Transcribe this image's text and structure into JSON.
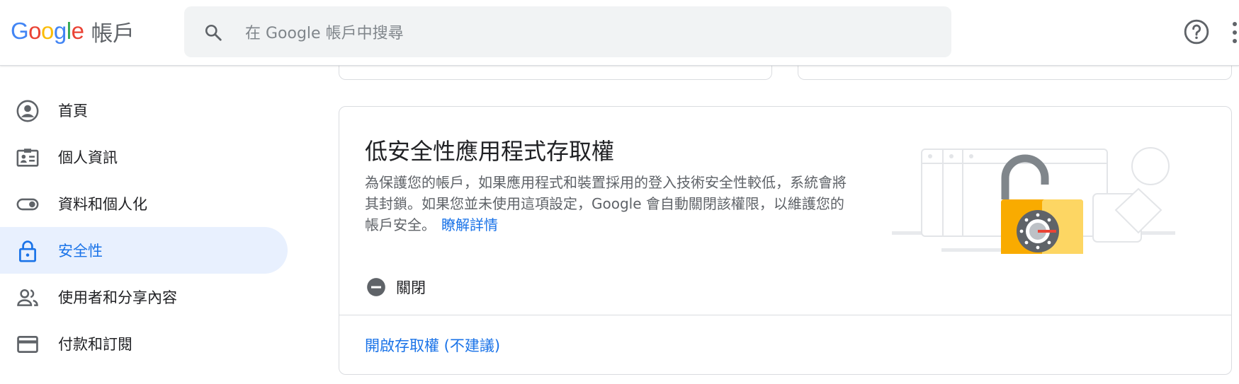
{
  "header": {
    "logo_letters": [
      "G",
      "o",
      "o",
      "g",
      "l",
      "e"
    ],
    "product_name": "帳戶",
    "search_placeholder": "在 Google 帳戶中搜尋"
  },
  "sidebar": {
    "items": [
      {
        "label": "首頁",
        "icon": "account-circle-icon",
        "active": false
      },
      {
        "label": "個人資訊",
        "icon": "id-card-icon",
        "active": false
      },
      {
        "label": "資料和個人化",
        "icon": "toggle-icon",
        "active": false
      },
      {
        "label": "安全性",
        "icon": "lock-icon",
        "active": true
      },
      {
        "label": "使用者和分享內容",
        "icon": "people-icon",
        "active": false
      },
      {
        "label": "付款和訂閱",
        "icon": "credit-card-icon",
        "active": false
      }
    ]
  },
  "card": {
    "title": "低安全性應用程式存取權",
    "description": "為保護您的帳戶，如果應用程式和裝置採用的登入技術安全性較低，系統會將其封鎖。如果您並未使用這項設定，Google 會自動關閉該權限，以維護您的帳戶安全。",
    "learn_more": "瞭解詳情",
    "status": "關閉",
    "action": "開啟存取權 (不建議)"
  },
  "colors": {
    "accent": "#1a73e8",
    "active_bg": "#e8f0fe",
    "lock_body": "#f9ab00"
  }
}
